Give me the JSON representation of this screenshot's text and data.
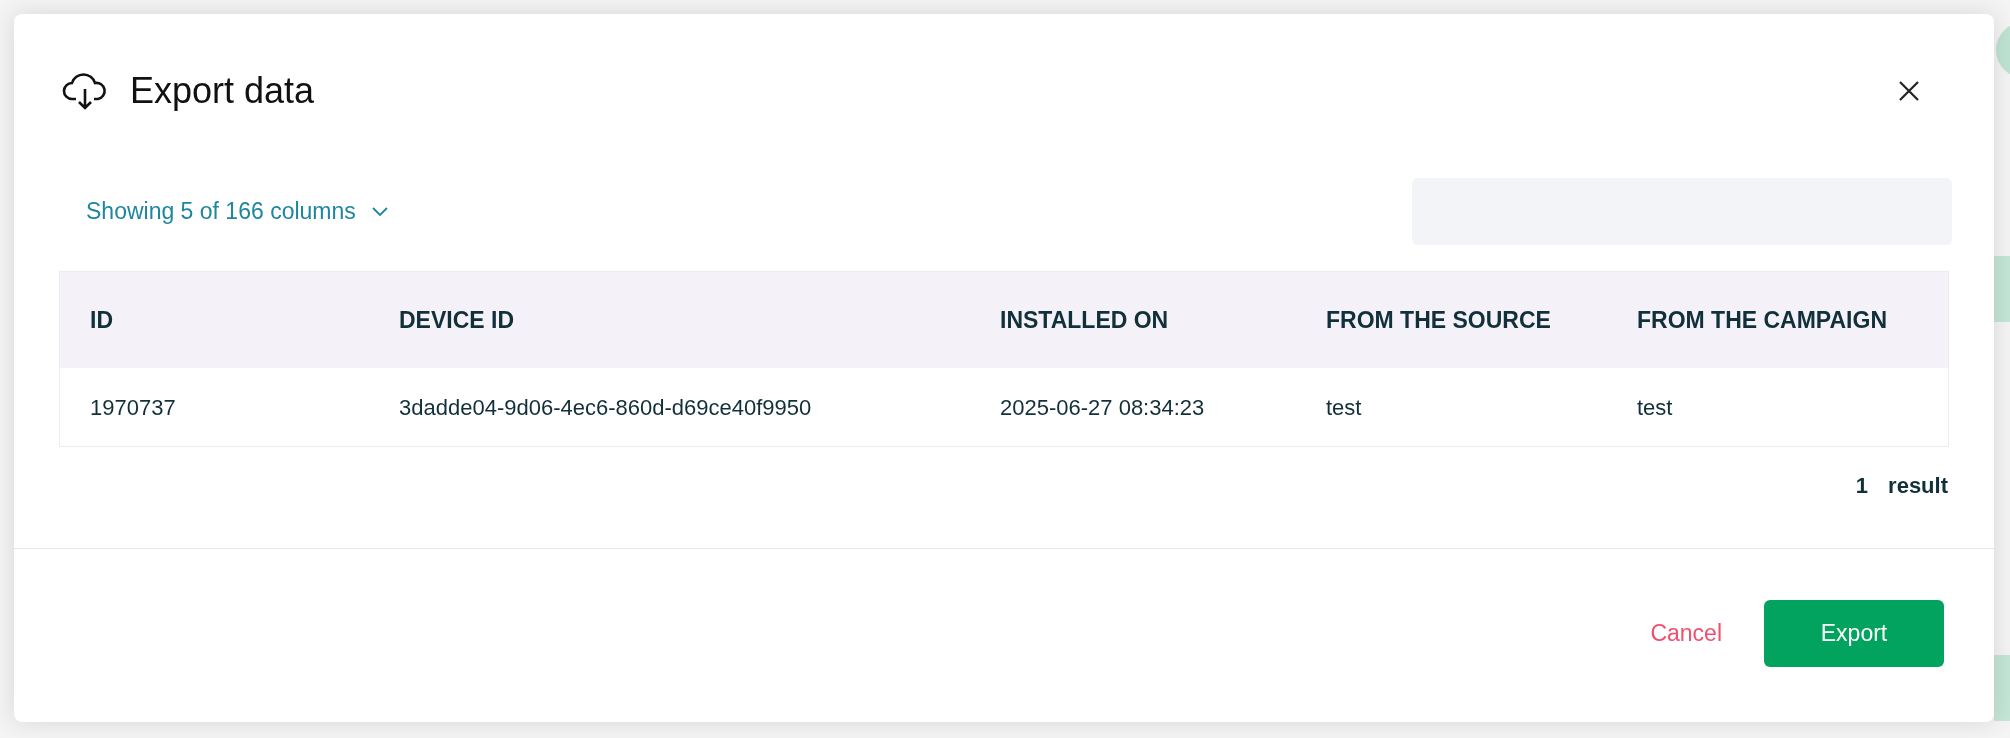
{
  "background": {
    "fragments": [
      {
        "kind": "tag"
      },
      {
        "kind": "tag"
      }
    ]
  },
  "dialog": {
    "title": "Export data",
    "columns_selector": "Showing 5 of 166 columns",
    "table": {
      "columns": [
        "ID",
        "DEVICE ID",
        "INSTALLED ON",
        "FROM THE SOURCE",
        "FROM THE CAMPAIGN"
      ],
      "rows": [
        [
          "1970737",
          "3dadde04-9d06-4ec6-860d-d69ce40f9950",
          "2025-06-27 08:34:23",
          "test",
          "test"
        ]
      ]
    },
    "result_count": "1",
    "result_label": "result",
    "buttons": [
      {
        "kind": "link",
        "label": "Cancel"
      },
      {
        "kind": "primary",
        "label": "Export"
      }
    ]
  }
}
